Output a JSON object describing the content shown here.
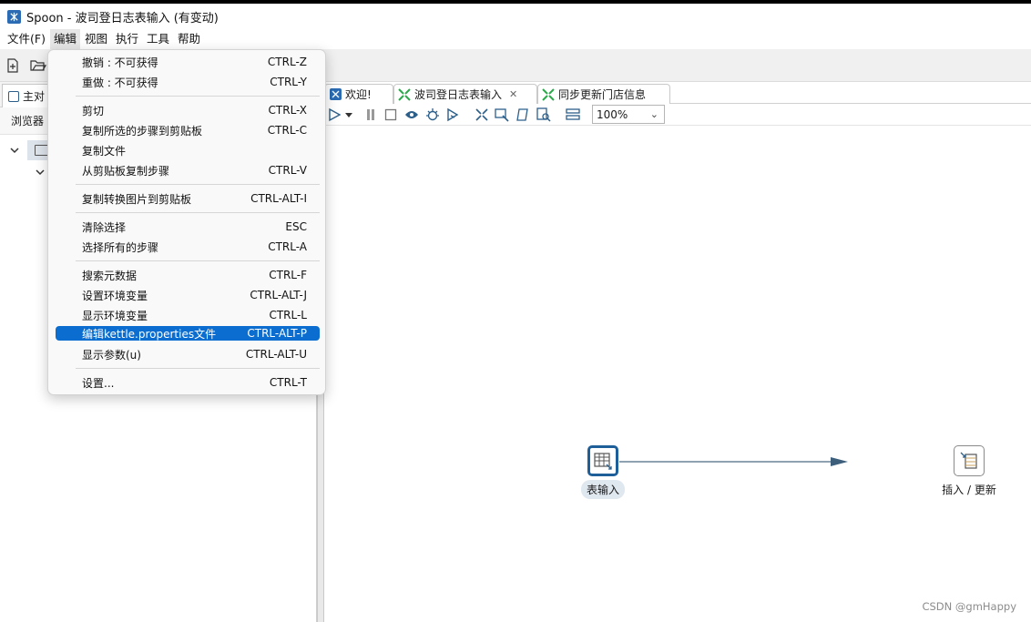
{
  "window": {
    "title": "Spoon - 波司登日志表输入 (有变动)"
  },
  "menubar": {
    "items": [
      "文件(F)",
      "编辑",
      "视图",
      "执行",
      "工具",
      "帮助"
    ],
    "open_index": 1
  },
  "left_panel": {
    "tab_label": "主对",
    "subtab_label": "浏览器"
  },
  "tabs": [
    {
      "label": "欢迎!",
      "icon": "spoon-icon"
    },
    {
      "label": "波司登日志表输入",
      "icon": "transformation-icon",
      "active": true,
      "closable": true
    },
    {
      "label": "同步更新门店信息",
      "icon": "transformation-icon"
    }
  ],
  "zoom": {
    "value": "100%"
  },
  "steps": [
    {
      "label": "表输入",
      "icon": "table-input-icon",
      "selected": true
    },
    {
      "label": "插入 / 更新",
      "icon": "insert-update-icon",
      "selected": false
    }
  ],
  "edit_menu": {
    "groups": [
      [
        {
          "label": "撤销 : 不可获得",
          "shortcut": "CTRL-Z"
        },
        {
          "label": "重做 : 不可获得",
          "shortcut": "CTRL-Y"
        }
      ],
      [
        {
          "label": "剪切",
          "shortcut": "CTRL-X"
        },
        {
          "label": "复制所选的步骤到剪贴板",
          "shortcut": "CTRL-C"
        },
        {
          "label": "复制文件",
          "shortcut": ""
        },
        {
          "label": "从剪贴板复制步骤",
          "shortcut": "CTRL-V"
        }
      ],
      [
        {
          "label": "复制转换图片到剪贴板",
          "shortcut": "CTRL-ALT-I"
        }
      ],
      [
        {
          "label": "清除选择",
          "shortcut": "ESC"
        },
        {
          "label": "选择所有的步骤",
          "shortcut": "CTRL-A"
        }
      ],
      [
        {
          "label": "搜索元数据",
          "shortcut": "CTRL-F"
        },
        {
          "label": "设置环境变量",
          "shortcut": "CTRL-ALT-J"
        },
        {
          "label": "显示环境变量",
          "shortcut": "CTRL-L"
        },
        {
          "label": "编辑kettle.properties文件",
          "shortcut": "CTRL-ALT-P",
          "highlighted": true
        },
        {
          "label": "显示参数(u)",
          "shortcut": "CTRL-ALT-U"
        }
      ],
      [
        {
          "label": "设置...",
          "shortcut": "CTRL-T"
        }
      ]
    ]
  },
  "watermark": "CSDN @gmHappy",
  "colors": {
    "accent": "#0a6dcf",
    "step_border": "#1f5f99",
    "hop": "#4a6b85"
  }
}
